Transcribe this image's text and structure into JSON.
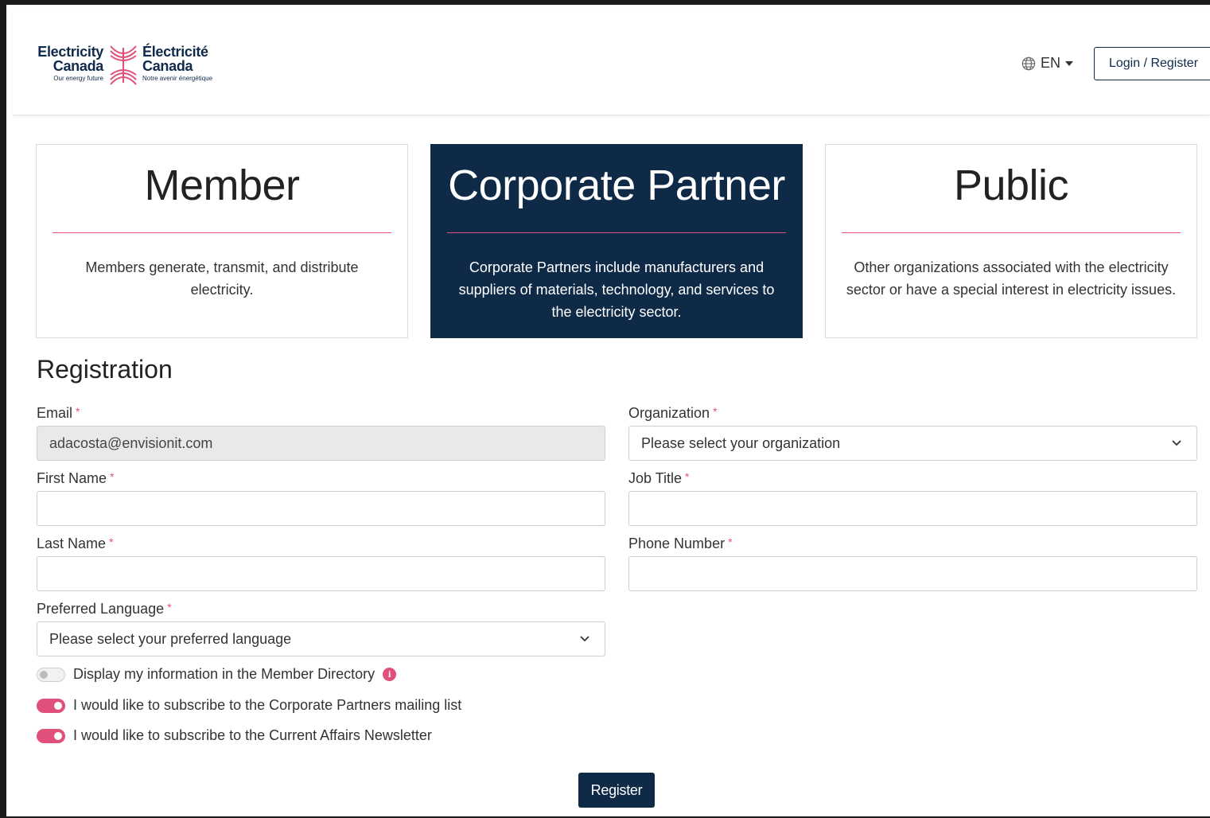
{
  "header": {
    "logo": {
      "en_name_line1": "Electricity",
      "en_name_line2": "Canada",
      "en_tagline": "Our energy future",
      "fr_name_line1": "Électricité",
      "fr_name_line2": "Canada",
      "fr_tagline": "Notre avenir énergétique"
    },
    "language": "EN",
    "login_register": "Login / Register"
  },
  "cards": [
    {
      "title": "Member",
      "description": "Members generate, transmit, and distribute electricity.",
      "active": false
    },
    {
      "title": "Corporate Partner",
      "description": "Corporate Partners include manufacturers and suppliers of materials, technology, and services to the electricity sector.",
      "active": true
    },
    {
      "title": "Public",
      "description": "Other organizations associated with the electricity sector or have a special interest in electricity issues.",
      "active": false
    }
  ],
  "registration": {
    "title": "Registration",
    "required_marker": "*",
    "email": {
      "label": "Email",
      "value": "adacosta@envisionit.com"
    },
    "organization": {
      "label": "Organization",
      "value": "Please select your organization"
    },
    "first_name": {
      "label": "First Name",
      "value": ""
    },
    "job_title": {
      "label": "Job Title",
      "value": ""
    },
    "last_name": {
      "label": "Last Name",
      "value": ""
    },
    "phone_number": {
      "label": "Phone Number",
      "value": ""
    },
    "preferred_language": {
      "label": "Preferred Language",
      "value": "Please select your preferred language"
    },
    "toggles": [
      {
        "label": "Display my information in the Member Directory",
        "on": false,
        "info": true
      },
      {
        "label": "I would like to subscribe to the Corporate Partners mailing list",
        "on": true,
        "info": false
      },
      {
        "label": "I would like to subscribe to the Current Affairs Newsletter",
        "on": true,
        "info": false
      }
    ],
    "submit_label": "Register"
  },
  "colors": {
    "navy": "#0e2a47",
    "accent_pink": "#e0507a",
    "readonly_bg": "#e8e9eb"
  },
  "icons": {
    "globe": "globe-icon",
    "caret": "caret-down-icon",
    "chevron": "chevron-down-icon",
    "info": "info-icon"
  }
}
